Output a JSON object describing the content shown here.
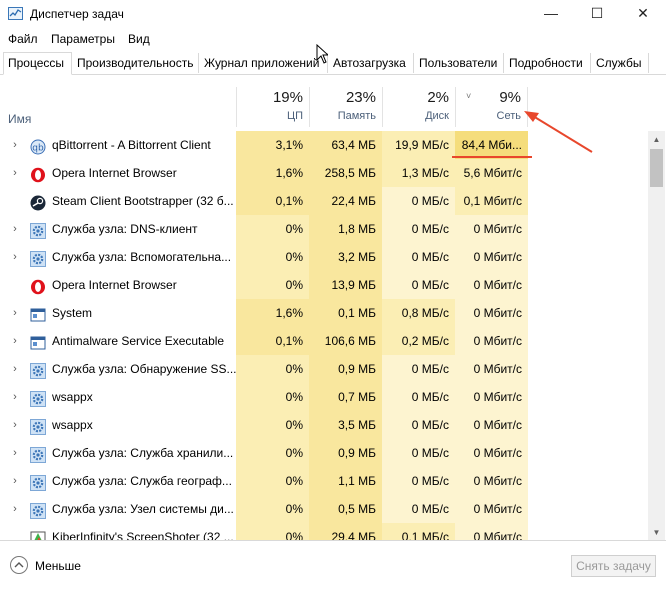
{
  "window": {
    "title": "Диспетчер задач",
    "minimize": "—",
    "maximize": "☐",
    "close": "✕"
  },
  "menu": [
    "Файл",
    "Параметры",
    "Вид"
  ],
  "tabs": [
    "Процессы",
    "Производительность",
    "Журнал приложений",
    "Автозагрузка",
    "Пользователи",
    "Подробности",
    "Службы"
  ],
  "active_tab": 0,
  "columns": {
    "name": "Имя",
    "cpu": {
      "pct": "19%",
      "label": "ЦП"
    },
    "mem": {
      "pct": "23%",
      "label": "Память"
    },
    "disk": {
      "pct": "2%",
      "label": "Диск"
    },
    "net": {
      "pct": "9%",
      "label": "Сеть",
      "sort": "˅"
    }
  },
  "colors": {
    "heat_light": "#fff4c4",
    "heat_med": "#f9eca9",
    "heat_strong": "#f5e08a",
    "annotation": "#e8472c",
    "header_text": "#4c607a"
  },
  "processes": [
    {
      "name": "qBittorrent - A Bittorrent Client",
      "icon": "qbittorrent-icon",
      "expand": true,
      "cpu": "3,1%",
      "mem": "63,4 МБ",
      "disk": "19,9 МБ/с",
      "net": "84,4 Мби..."
    },
    {
      "name": "Opera Internet Browser",
      "icon": "opera-icon",
      "expand": true,
      "cpu": "1,6%",
      "mem": "258,5 МБ",
      "disk": "1,3 МБ/с",
      "net": "5,6 Мбит/с"
    },
    {
      "name": "Steam Client Bootstrapper (32 б...",
      "icon": "steam-icon",
      "expand": false,
      "cpu": "0,1%",
      "mem": "22,4 МБ",
      "disk": "0 МБ/с",
      "net": "0,1 Мбит/с"
    },
    {
      "name": "Служба узла: DNS-клиент",
      "icon": "service-gear-icon",
      "expand": true,
      "cpu": "0%",
      "mem": "1,8 МБ",
      "disk": "0 МБ/с",
      "net": "0 Мбит/с"
    },
    {
      "name": "Служба узла: Вспомогательна...",
      "icon": "service-gear-icon",
      "expand": true,
      "cpu": "0%",
      "mem": "3,2 МБ",
      "disk": "0 МБ/с",
      "net": "0 Мбит/с"
    },
    {
      "name": "Opera Internet Browser",
      "icon": "opera-icon",
      "expand": false,
      "cpu": "0%",
      "mem": "13,9 МБ",
      "disk": "0 МБ/с",
      "net": "0 Мбит/с"
    },
    {
      "name": "System",
      "icon": "system-window-icon",
      "expand": true,
      "cpu": "1,6%",
      "mem": "0,1 МБ",
      "disk": "0,8 МБ/с",
      "net": "0 Мбит/с"
    },
    {
      "name": "Antimalware Service Executable",
      "icon": "system-window-icon",
      "expand": true,
      "cpu": "0,1%",
      "mem": "106,6 МБ",
      "disk": "0,2 МБ/с",
      "net": "0 Мбит/с"
    },
    {
      "name": "Служба узла: Обнаружение SS...",
      "icon": "service-gear-icon",
      "expand": true,
      "cpu": "0%",
      "mem": "0,9 МБ",
      "disk": "0 МБ/с",
      "net": "0 Мбит/с"
    },
    {
      "name": "wsappx",
      "icon": "service-gear-icon",
      "expand": true,
      "cpu": "0%",
      "mem": "0,7 МБ",
      "disk": "0 МБ/с",
      "net": "0 Мбит/с"
    },
    {
      "name": "wsappx",
      "icon": "service-gear-icon",
      "expand": true,
      "cpu": "0%",
      "mem": "3,5 МБ",
      "disk": "0 МБ/с",
      "net": "0 Мбит/с"
    },
    {
      "name": "Служба узла: Служба хранили...",
      "icon": "service-gear-icon",
      "expand": true,
      "cpu": "0%",
      "mem": "0,9 МБ",
      "disk": "0 МБ/с",
      "net": "0 Мбит/с"
    },
    {
      "name": "Служба узла: Служба географ...",
      "icon": "service-gear-icon",
      "expand": true,
      "cpu": "0%",
      "mem": "1,1 МБ",
      "disk": "0 МБ/с",
      "net": "0 Мбит/с"
    },
    {
      "name": "Служба узла: Узел системы ди...",
      "icon": "service-gear-icon",
      "expand": true,
      "cpu": "0%",
      "mem": "0,5 МБ",
      "disk": "0 МБ/с",
      "net": "0 Мбит/с"
    },
    {
      "name": "KiberInfinity's ScreenShoter (32 ...",
      "icon": "screenshoter-icon",
      "expand": false,
      "cpu": "0%",
      "mem": "29,4 МБ",
      "disk": "0,1 МБ/с",
      "net": "0 Мбит/с"
    }
  ],
  "footer": {
    "fewer": "Меньше",
    "end_task": "Снять задачу"
  }
}
